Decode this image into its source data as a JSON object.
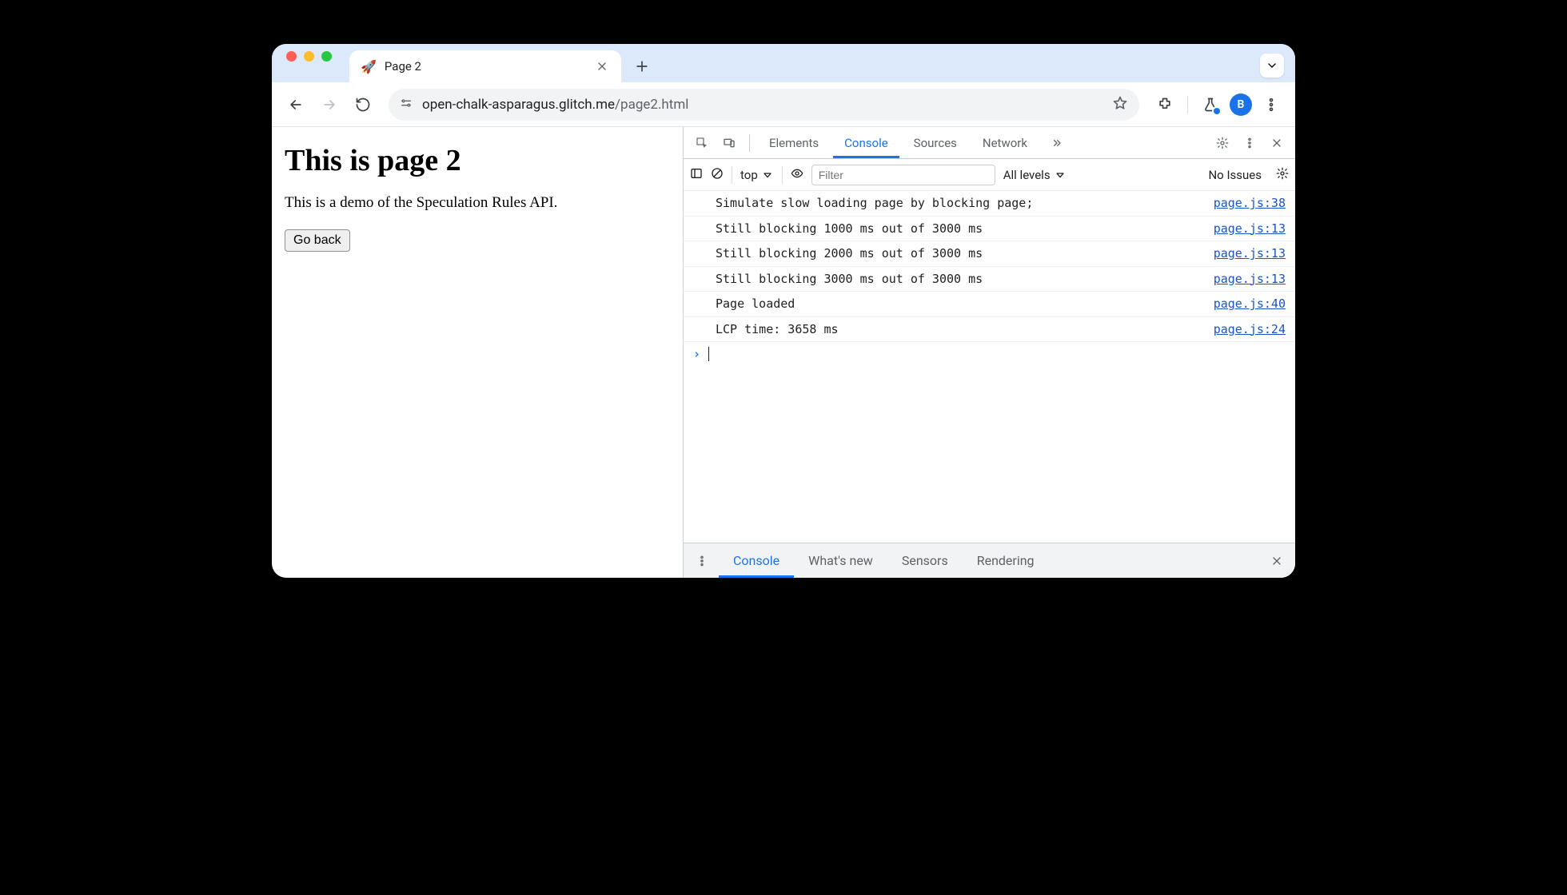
{
  "browser": {
    "tab": {
      "favicon": "🚀",
      "title": "Page 2"
    },
    "url_host": "open-chalk-asparagus.glitch.me",
    "url_path": "/page2.html",
    "avatar_letter": "B"
  },
  "page": {
    "heading": "This is page 2",
    "paragraph": "This is a demo of the Speculation Rules API.",
    "back_button": "Go back"
  },
  "devtools": {
    "tabs": [
      "Elements",
      "Console",
      "Sources",
      "Network"
    ],
    "active_tab": "Console",
    "toolbar": {
      "context": "top",
      "filter_placeholder": "Filter",
      "levels": "All levels",
      "issues": "No Issues"
    },
    "logs": [
      {
        "msg": "Simulate slow loading page by blocking page;",
        "src": "page.js:38"
      },
      {
        "msg": "Still blocking 1000 ms out of 3000 ms",
        "src": "page.js:13"
      },
      {
        "msg": "Still blocking 2000 ms out of 3000 ms",
        "src": "page.js:13"
      },
      {
        "msg": "Still blocking 3000 ms out of 3000 ms",
        "src": "page.js:13"
      },
      {
        "msg": "Page loaded",
        "src": "page.js:40"
      },
      {
        "msg": "LCP time: 3658 ms",
        "src": "page.js:24"
      }
    ],
    "drawer_tabs": [
      "Console",
      "What's new",
      "Sensors",
      "Rendering"
    ],
    "active_drawer_tab": "Console"
  }
}
